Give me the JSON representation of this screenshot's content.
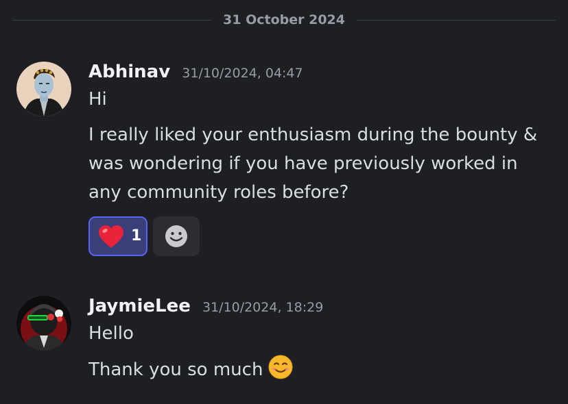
{
  "date_divider": "31 October 2024",
  "messages": [
    {
      "username": "Abhinav",
      "timestamp": "31/10/2024, 04:47",
      "lines": [
        "Hi",
        "I really liked your enthusiasm during the bounty &",
        "was wondering if you have previously worked in",
        "any community roles before?"
      ],
      "reactions": [
        {
          "emoji": "heart-emoji",
          "count": "1"
        }
      ],
      "add_reaction_icon": "smile-add-reaction-icon"
    },
    {
      "username": "JaymieLee",
      "timestamp": "31/10/2024, 18:29",
      "lines": [
        "Hello",
        "Thank you so much"
      ],
      "inline_emoji": "smiling-face-emoji"
    }
  ],
  "colors": {
    "background": "#1e1f25",
    "username": "#f2f3f5",
    "muted": "#9a9ca4",
    "reaction_active_bg": "#3a3f7a",
    "reaction_active_border": "#5865f2"
  }
}
